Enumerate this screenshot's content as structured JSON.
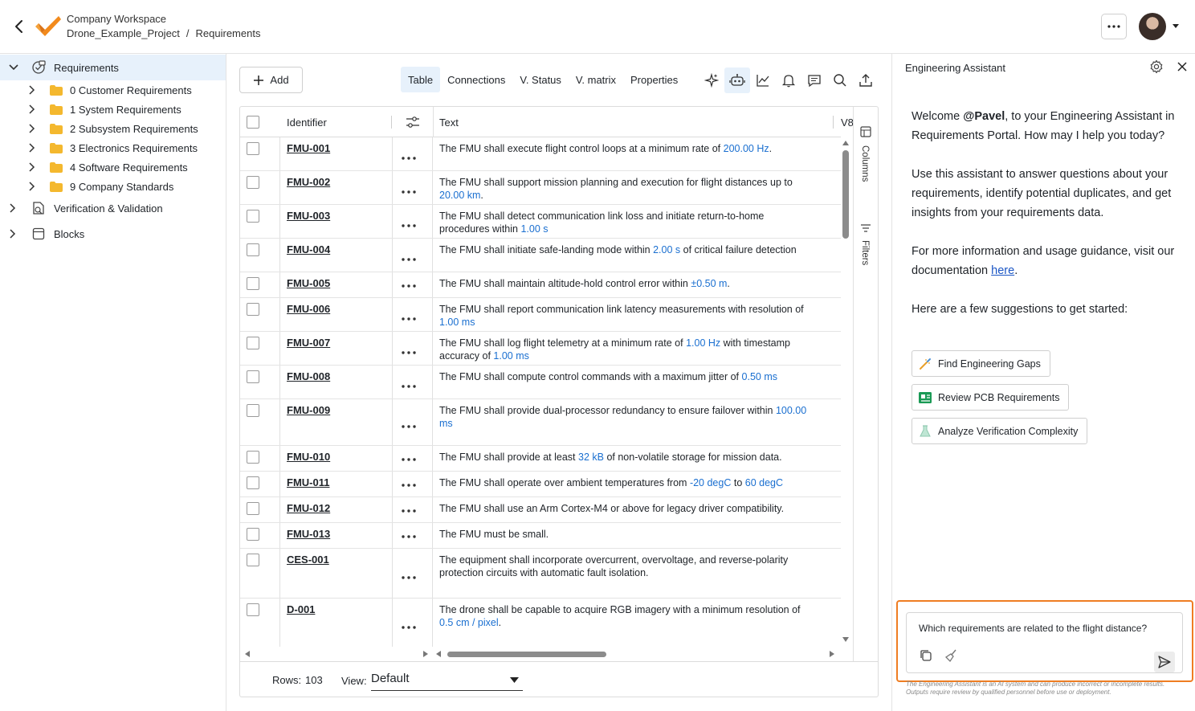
{
  "header": {
    "workspace": "Company Workspace",
    "project": "Drone_Example_Project",
    "separator": "/",
    "page": "Requirements"
  },
  "sidebar": {
    "requirements_label": "Requirements",
    "folders": [
      {
        "label": "0 Customer Requirements"
      },
      {
        "label": "1 System Requirements"
      },
      {
        "label": "2 Subsystem Requirements"
      },
      {
        "label": "3 Electronics Requirements"
      },
      {
        "label": "4 Software Requirements"
      },
      {
        "label": "9 Company Standards"
      }
    ],
    "vv_label": "Verification & Validation",
    "blocks_label": "Blocks"
  },
  "toolbar": {
    "add_label": "Add",
    "tabs": [
      {
        "label": "Table",
        "active": true
      },
      {
        "label": "Connections"
      },
      {
        "label": "V. Status"
      },
      {
        "label": "V. matrix"
      },
      {
        "label": "Properties"
      }
    ],
    "icons": [
      "ai-sparkle-icon",
      "robot-icon",
      "chart-icon",
      "bell-icon",
      "comment-icon",
      "search-icon",
      "export-icon"
    ]
  },
  "table": {
    "headers": {
      "identifier": "Identifier",
      "text": "Text",
      "next": "V8"
    },
    "rows": [
      {
        "id": "FMU-001",
        "parts": [
          {
            "t": "The FMU shall execute flight control loops at a minimum rate of "
          },
          {
            "t": "200.00  Hz",
            "v": true
          },
          {
            "t": "."
          }
        ]
      },
      {
        "id": "FMU-002",
        "parts": [
          {
            "t": "The FMU shall support mission planning and execution for flight distances up to "
          },
          {
            "t": "20.00  km",
            "v": true
          },
          {
            "t": "."
          }
        ]
      },
      {
        "id": "FMU-003",
        "parts": [
          {
            "t": "The FMU shall detect communication link loss and initiate return-to-home procedures within "
          },
          {
            "t": "1.00  s",
            "v": true
          }
        ]
      },
      {
        "id": "FMU-004",
        "parts": [
          {
            "t": "The FMU shall initiate safe-landing mode within "
          },
          {
            "t": "2.00  s",
            "v": true
          },
          {
            "t": " of critical failure detection"
          }
        ]
      },
      {
        "id": "FMU-005",
        "parts": [
          {
            "t": "The FMU shall maintain altitude-hold control error within "
          },
          {
            "t": "±0.50  m",
            "v": true
          },
          {
            "t": "."
          }
        ]
      },
      {
        "id": "FMU-006",
        "parts": [
          {
            "t": "The FMU shall report communication link latency measurements with resolution of "
          },
          {
            "t": "1.00  ms",
            "v": true
          }
        ]
      },
      {
        "id": "FMU-007",
        "parts": [
          {
            "t": "The FMU shall log flight telemetry at a minimum rate of "
          },
          {
            "t": "1.00  Hz",
            "v": true
          },
          {
            "t": " with timestamp accuracy of "
          },
          {
            "t": "1.00  ms",
            "v": true
          }
        ]
      },
      {
        "id": "FMU-008",
        "parts": [
          {
            "t": "The FMU shall compute control commands with a maximum jitter of "
          },
          {
            "t": "0.50  ms",
            "v": true
          }
        ]
      },
      {
        "id": "FMU-009",
        "parts": [
          {
            "t": "The FMU shall provide dual-processor redundancy to ensure failover within "
          },
          {
            "t": "100.00  ms",
            "v": true
          }
        ]
      },
      {
        "id": "FMU-010",
        "parts": [
          {
            "t": "The FMU shall provide at least "
          },
          {
            "t": "32  kB",
            "v": true
          },
          {
            "t": " of non-volatile storage for mission data."
          }
        ]
      },
      {
        "id": "FMU-011",
        "parts": [
          {
            "t": "The FMU shall operate over ambient temperatures from "
          },
          {
            "t": "-20  degC",
            "v": true
          },
          {
            "t": " to "
          },
          {
            "t": "60  degC",
            "v": true
          }
        ]
      },
      {
        "id": "FMU-012",
        "parts": [
          {
            "t": "The FMU shall use an Arm Cortex-M4 or above for legacy driver compatibility."
          }
        ]
      },
      {
        "id": "FMU-013",
        "parts": [
          {
            "t": "The FMU must be small."
          }
        ]
      },
      {
        "id": "CES-001",
        "parts": [
          {
            "t": "The equipment shall incorporate overcurrent, overvoltage, and reverse-polarity protection circuits with automatic fault isolation."
          }
        ]
      },
      {
        "id": "D-001",
        "parts": [
          {
            "t": "The drone shall be capable to acquire RGB imagery with a minimum resolution of "
          },
          {
            "t": "0.5  cm / pixel",
            "v": true
          },
          {
            "t": "."
          }
        ]
      }
    ],
    "rail": {
      "columns": "Columns",
      "filters": "Filters"
    },
    "footer": {
      "rows_label": "Rows:",
      "rows_value": "103",
      "view_label": "View:",
      "view_value": "Default"
    }
  },
  "assistant": {
    "title": "Engineering Assistant",
    "welcome_prefix": "Welcome ",
    "user": "@Pavel",
    "welcome_suffix": ", to your Engineering Assistant in Requirements Portal. How may I help you today?",
    "para2": "Use this assistant to answer questions about your requirements, identify potential duplicates, and get insights from your requirements data.",
    "para3_prefix": "For more information and usage guidance, visit our documentation ",
    "para3_link": "here",
    "para3_suffix": ".",
    "para4": "Here are a few suggestions to get started:",
    "suggestions": [
      {
        "label": "Find Engineering Gaps",
        "icon": "wand-icon"
      },
      {
        "label": "Review PCB Requirements",
        "icon": "pcb-icon"
      },
      {
        "label": "Analyze Verification Complexity",
        "icon": "flask-icon"
      }
    ],
    "input_value": "Which requirements are related to the flight distance?",
    "disclaimer": "The Engineering Assistant is an AI system and can produce incorrect or incomplete results. Outputs require review by qualified personnel before use or deployment."
  },
  "colors": {
    "accent": "#1a6fd0",
    "highlight": "#ef7d22",
    "selected_bg": "#e7f1fb",
    "logo": "#f28a1c"
  }
}
